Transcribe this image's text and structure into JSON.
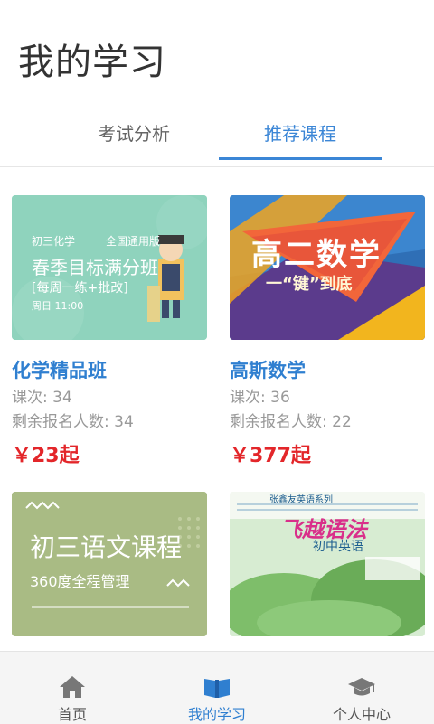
{
  "page": {
    "title": "我的学习"
  },
  "tabs": [
    {
      "label": "考试分析"
    },
    {
      "label": "推荐课程"
    }
  ],
  "courses": [
    {
      "title": "化学精品班",
      "lessons": "课次: 34",
      "remaining": "剩余报名人数: 34",
      "price": "￥23起",
      "thumb": {
        "tag": "初三化学",
        "edition": "全国通用版",
        "headline": "春季目标满分班",
        "sub": "[每周一练+批改]",
        "time": "周日 11:00",
        "bg": "#8fd3bd"
      }
    },
    {
      "title": "高斯数学",
      "lessons": "课次: 36",
      "remaining": "剩余报名人数: 22",
      "price": "￥377起",
      "thumb": {
        "headline": "高二数学",
        "sub": "一“键”到底"
      }
    },
    {
      "title": "",
      "lessons": "",
      "remaining": "",
      "price": "",
      "thumb": {
        "headline": "初三语文课程",
        "sub": "360度全程管理",
        "bg": "#a9bb84"
      }
    },
    {
      "title": "",
      "lessons": "",
      "remaining": "",
      "price": "",
      "thumb": {
        "series": "张鑫友英语系列",
        "headline": "飞越语法",
        "sub": "初中英语"
      }
    }
  ],
  "bottom_nav": [
    {
      "label": "首页",
      "icon": "home-icon"
    },
    {
      "label": "我的学习",
      "icon": "book-icon",
      "active": true
    },
    {
      "label": "个人中心",
      "icon": "graduation-cap-icon"
    }
  ],
  "colors": {
    "accent": "#2f7fd0",
    "price": "#e3262a"
  }
}
